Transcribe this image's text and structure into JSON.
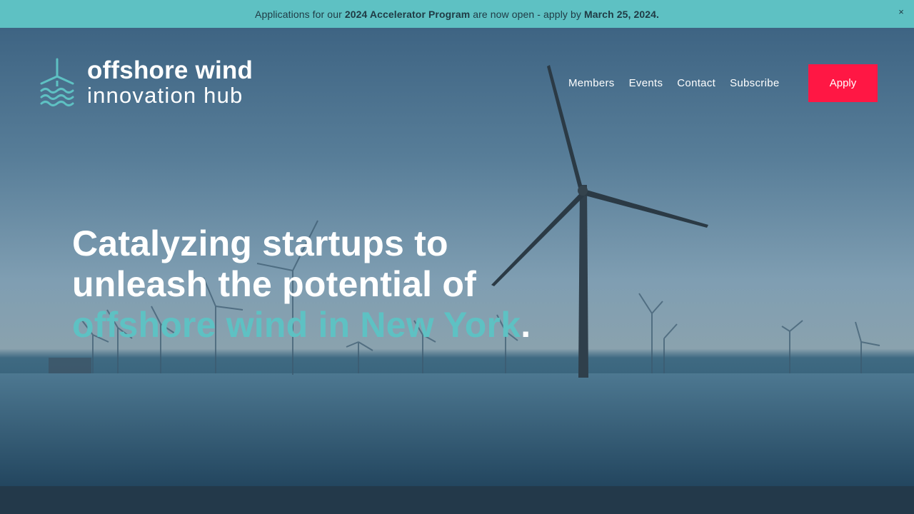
{
  "announcement": {
    "prefix": "Applications for our ",
    "program": "2024 Accelerator Program",
    "middle": " are now open - apply by ",
    "deadline": "March 25, 2024.",
    "close_glyph": "×"
  },
  "brand": {
    "line1": "offshore wind",
    "line2": "innovation hub",
    "logo_icon": "wind-turbine-waves-icon",
    "accent_color": "#5ec1c3"
  },
  "nav": {
    "items": [
      "Members",
      "Events",
      "Contact",
      "Subscribe"
    ],
    "apply_label": "Apply",
    "apply_color": "#ff1744"
  },
  "hero": {
    "headline_line1": "Catalyzing startups to",
    "headline_line2": "unleash the potential of",
    "headline_accent": "offshore wind in New York",
    "headline_period": "."
  }
}
